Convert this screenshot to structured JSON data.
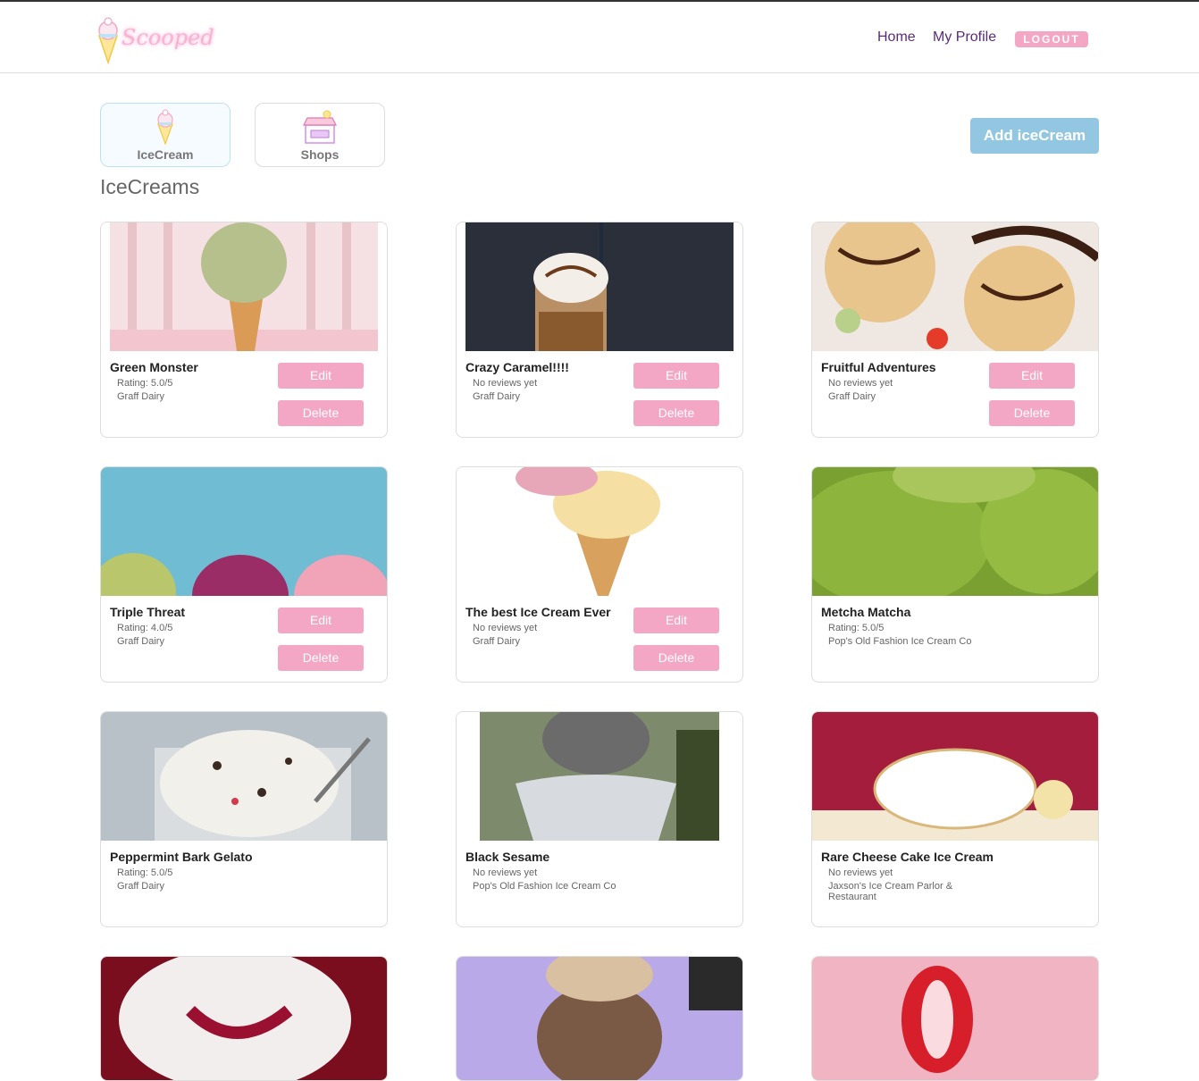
{
  "header": {
    "logo_text": "Scooped",
    "nav": {
      "home": "Home",
      "profile": "My Profile",
      "logout": "LOGOUT"
    }
  },
  "tabs": [
    {
      "label": "IceCream"
    },
    {
      "label": "Shops"
    }
  ],
  "add_button": "Add iceCream",
  "section_title": "IceCreams",
  "edit_label": "Edit",
  "delete_label": "Delete",
  "cards": [
    {
      "name": "Green Monster",
      "rating": "Rating: 5.0/5",
      "shop": "Graff Dairy"
    },
    {
      "name": "Crazy Caramel!!!!",
      "rating": "No reviews yet",
      "shop": "Graff Dairy"
    },
    {
      "name": "Fruitful Adventures",
      "rating": "No reviews yet",
      "shop": "Graff Dairy"
    },
    {
      "name": "Triple Threat",
      "rating": "Rating: 4.0/5",
      "shop": "Graff Dairy"
    },
    {
      "name": "The best Ice Cream Ever",
      "rating": "No reviews yet",
      "shop": "Graff Dairy"
    },
    {
      "name": "Metcha Matcha",
      "rating": "Rating: 5.0/5",
      "shop": "Pop's Old Fashion Ice Cream Co"
    },
    {
      "name": "Peppermint Bark Gelato",
      "rating": "Rating: 5.0/5",
      "shop": "Graff Dairy"
    },
    {
      "name": "Black Sesame",
      "rating": "No reviews yet",
      "shop": "Pop's Old Fashion Ice Cream Co"
    },
    {
      "name": "Rare Cheese Cake Ice Cream",
      "rating": "No reviews yet",
      "shop": "Jaxson's Ice Cream Parlor & Restaurant"
    }
  ]
}
